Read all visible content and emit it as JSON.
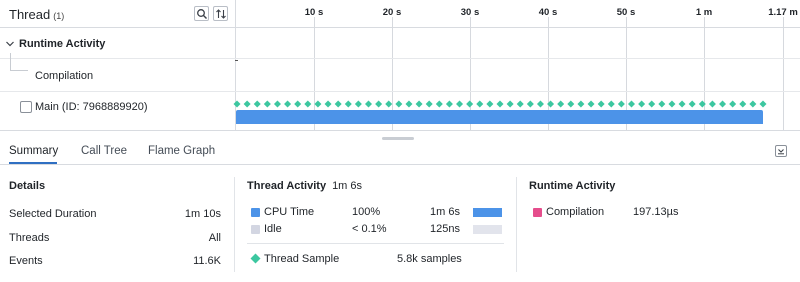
{
  "header": {
    "title": "Thread",
    "count": "(1)"
  },
  "ruler": {
    "ticks": [
      "10 s",
      "20 s",
      "30 s",
      "40 s",
      "50 s",
      "1 m",
      "1.17 m"
    ]
  },
  "tree": {
    "runtime_activity": "Runtime Activity",
    "compilation": "Compilation",
    "main_thread": "Main (ID: 7968889920)"
  },
  "timeline": {
    "bar_color": "#4c93e8",
    "sample_color": "#3cc7a0",
    "sample_diamonds": 53
  },
  "tabs": [
    "Summary",
    "Call Tree",
    "Flame Graph"
  ],
  "active_tab": "Summary",
  "details": {
    "title": "Details",
    "rows": [
      {
        "label": "Selected Duration",
        "value": "1m 10s"
      },
      {
        "label": "Threads",
        "value": "All"
      },
      {
        "label": "Events",
        "value": "11.6K"
      }
    ]
  },
  "thread_activity": {
    "title": "Thread Activity",
    "duration": "1m 6s",
    "rows": [
      {
        "label": "CPU Time",
        "percent": "100%",
        "time": "1m 6s",
        "color": "#4c93e8",
        "fill": 1.0
      },
      {
        "label": "Idle",
        "percent": "< 0.1%",
        "time": "125ns",
        "color": "#d3d6e2",
        "fill": 0.001
      }
    ],
    "sample": {
      "label": "Thread Sample",
      "value": "5.8k samples",
      "color": "#3cc7a0"
    }
  },
  "runtime_activity": {
    "title": "Runtime Activity",
    "rows": [
      {
        "label": "Compilation",
        "value": "197.13µs",
        "color": "#e54d8c"
      }
    ]
  },
  "icons": {
    "search": "search-icon",
    "sort": "sort-icon",
    "expand": "chevron-down-icon",
    "collapse": "collapse-panel-icon"
  }
}
